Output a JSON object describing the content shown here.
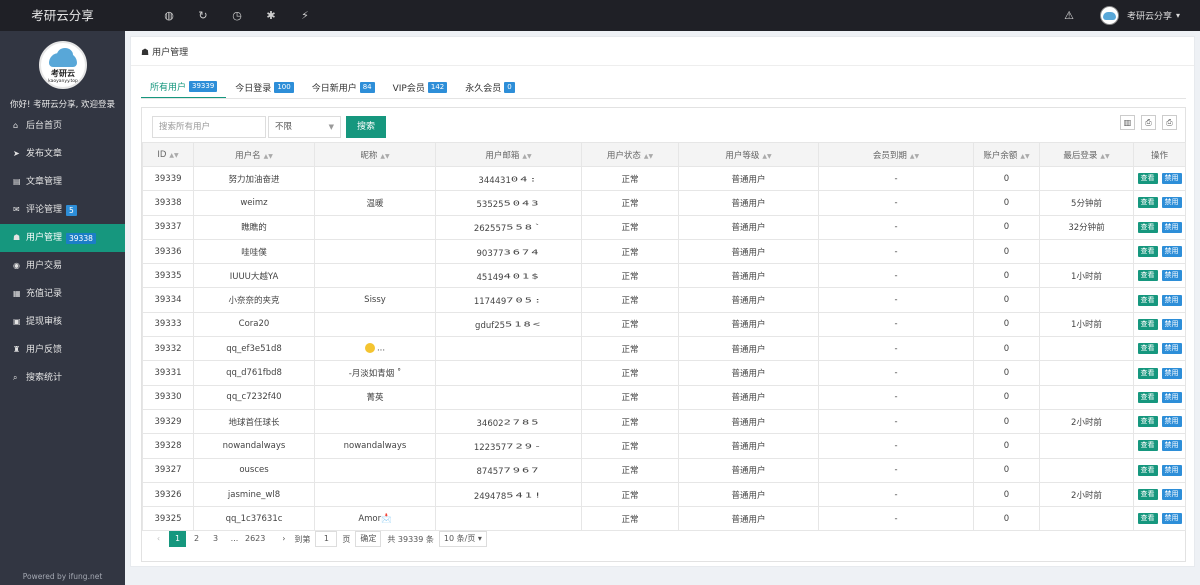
{
  "topbar": {
    "brand": "考研云分享",
    "icons": [
      "globe-icon",
      "refresh-icon",
      "dashboard-icon",
      "settings-icon",
      "plug-icon"
    ],
    "icon_glyphs": [
      "◍",
      "↻",
      "◷",
      "✱",
      "⚡"
    ],
    "warn_glyph": "⚠",
    "user_name": "考研云分享",
    "caret": "▾"
  },
  "sidebar": {
    "logo_text": "考研云",
    "logo_sub": "kaoyanyy.top",
    "welcome": "你好! 考研云分享, 欢迎登录",
    "items": [
      {
        "label": "后台首页",
        "icon": "home-icon",
        "glyph": "⌂",
        "badge": ""
      },
      {
        "label": "发布文章",
        "icon": "send-icon",
        "glyph": "➤",
        "badge": ""
      },
      {
        "label": "文章管理",
        "icon": "book-icon",
        "glyph": "▤",
        "badge": ""
      },
      {
        "label": "评论管理",
        "icon": "comments-icon",
        "glyph": "✉",
        "badge": "5"
      },
      {
        "label": "用户管理",
        "icon": "users-icon",
        "glyph": "☗",
        "badge": "39338"
      },
      {
        "label": "用户交易",
        "icon": "eye-icon",
        "glyph": "◉",
        "badge": ""
      },
      {
        "label": "充值记录",
        "icon": "list-icon",
        "glyph": "▦",
        "badge": ""
      },
      {
        "label": "提现审核",
        "icon": "money-icon",
        "glyph": "▣",
        "badge": ""
      },
      {
        "label": "用户反馈",
        "icon": "feedback-icon",
        "glyph": "♜",
        "badge": ""
      },
      {
        "label": "搜索统计",
        "icon": "search-icon",
        "glyph": "⌕",
        "badge": ""
      }
    ],
    "powered": "Powered by ifung.net"
  },
  "panel": {
    "title": "用户管理",
    "tabs": [
      {
        "label": "所有用户",
        "badge": "39339"
      },
      {
        "label": "今日登录",
        "badge": "100"
      },
      {
        "label": "今日新用户",
        "badge": "84"
      },
      {
        "label": "VIP会员",
        "badge": "142"
      },
      {
        "label": "永久会员",
        "badge": "0"
      }
    ],
    "search_placeholder": "搜索所有用户",
    "filter_value": "不限",
    "search_button": "搜索",
    "columns": [
      "ID",
      "用户名",
      "昵称",
      "用户邮箱",
      "用户状态",
      "用户等级",
      "会员到期",
      "账户余额",
      "最后登录",
      "操作"
    ],
    "view_label": "查看",
    "ban_label": "禁用",
    "rows": [
      {
        "id": "39339",
        "username": "努力加油奋进",
        "nickname": "",
        "email_prefix": "344431",
        "email_mask": "04:",
        "status": "正常",
        "level": "普通用户",
        "expire": "-",
        "balance": "0",
        "last_login": ""
      },
      {
        "id": "39338",
        "username": "weimz",
        "nickname": "温暖",
        "email_prefix": "53525",
        "email_mask": "5043",
        "status": "正常",
        "level": "普通用户",
        "expire": "-",
        "balance": "0",
        "last_login": "5分钟前"
      },
      {
        "id": "39337",
        "username": "瞧瞧的",
        "nickname": "",
        "email_prefix": "262557",
        "email_mask": "558`",
        "status": "正常",
        "level": "普通用户",
        "expire": "-",
        "balance": "0",
        "last_login": "32分钟前"
      },
      {
        "id": "39336",
        "username": "哇哇僕",
        "nickname": "",
        "email_prefix": "90377",
        "email_mask": "3674",
        "status": "正常",
        "level": "普通用户",
        "expire": "-",
        "balance": "0",
        "last_login": ""
      },
      {
        "id": "39335",
        "username": "IUUU大越YA",
        "nickname": "",
        "email_prefix": "45149",
        "email_mask": "401$",
        "status": "正常",
        "level": "普通用户",
        "expire": "-",
        "balance": "0",
        "last_login": "1小时前"
      },
      {
        "id": "39334",
        "username": "小奈奈的夹克",
        "nickname": "Sissy",
        "email_prefix": "117449",
        "email_mask": "705:",
        "status": "正常",
        "level": "普通用户",
        "expire": "-",
        "balance": "0",
        "last_login": ""
      },
      {
        "id": "39333",
        "username": "Cora20",
        "nickname": "",
        "email_prefix": "gduf25",
        "email_mask": "518<",
        "status": "正常",
        "level": "普通用户",
        "expire": "-",
        "balance": "0",
        "last_login": "1小时前"
      },
      {
        "id": "39332",
        "username": "qq_ef3e51d8",
        "nickname": "...",
        "nick_emoji": true,
        "email_prefix": "",
        "email_mask": "",
        "status": "正常",
        "level": "普通用户",
        "expire": "-",
        "balance": "0",
        "last_login": ""
      },
      {
        "id": "39331",
        "username": "qq_d761fbd8",
        "nickname": "-月淡如青烟 ˚",
        "email_prefix": "",
        "email_mask": "",
        "status": "正常",
        "level": "普通用户",
        "expire": "-",
        "balance": "0",
        "last_login": ""
      },
      {
        "id": "39330",
        "username": "qq_c7232f40",
        "nickname": "菁英",
        "email_prefix": "",
        "email_mask": "",
        "status": "正常",
        "level": "普通用户",
        "expire": "-",
        "balance": "0",
        "last_login": ""
      },
      {
        "id": "39329",
        "username": "地球首任球长",
        "nickname": "",
        "email_prefix": "34602",
        "email_mask": "2785",
        "status": "正常",
        "level": "普通用户",
        "expire": "-",
        "balance": "0",
        "last_login": "2小时前"
      },
      {
        "id": "39328",
        "username": "nowandalways",
        "nickname": "nowandalways",
        "email_prefix": "122357",
        "email_mask": "729-",
        "status": "正常",
        "level": "普通用户",
        "expire": "-",
        "balance": "0",
        "last_login": ""
      },
      {
        "id": "39327",
        "username": "ousces",
        "nickname": "",
        "email_prefix": "87457",
        "email_mask": "7967",
        "status": "正常",
        "level": "普通用户",
        "expire": "-",
        "balance": "0",
        "last_login": ""
      },
      {
        "id": "39326",
        "username": "jasmine_wl8",
        "nickname": "",
        "email_prefix": "249478",
        "email_mask": "541!",
        "status": "正常",
        "level": "普通用户",
        "expire": "-",
        "balance": "0",
        "last_login": "2小时前"
      },
      {
        "id": "39325",
        "username": "qq_1c37631c",
        "nickname": "Amor📩",
        "email_prefix": "",
        "email_mask": "",
        "status": "正常",
        "level": "普通用户",
        "expire": "-",
        "balance": "0",
        "last_login": ""
      }
    ],
    "pager": {
      "prev": "‹",
      "pages": [
        "1",
        "2",
        "3",
        "...",
        "2623"
      ],
      "next": "›",
      "goto_label": "到第",
      "goto_value": "1",
      "page_unit": "页",
      "confirm": "确定",
      "total": "共 39339 条",
      "page_size": "10 条/页 ▾"
    },
    "tool_glyphs": [
      "▥",
      "⎙",
      "⎙"
    ]
  },
  "colors": {
    "accent": "#16977e",
    "badge": "#2d8ed8",
    "sidebar": "#323642",
    "topbar": "#1f2026"
  }
}
